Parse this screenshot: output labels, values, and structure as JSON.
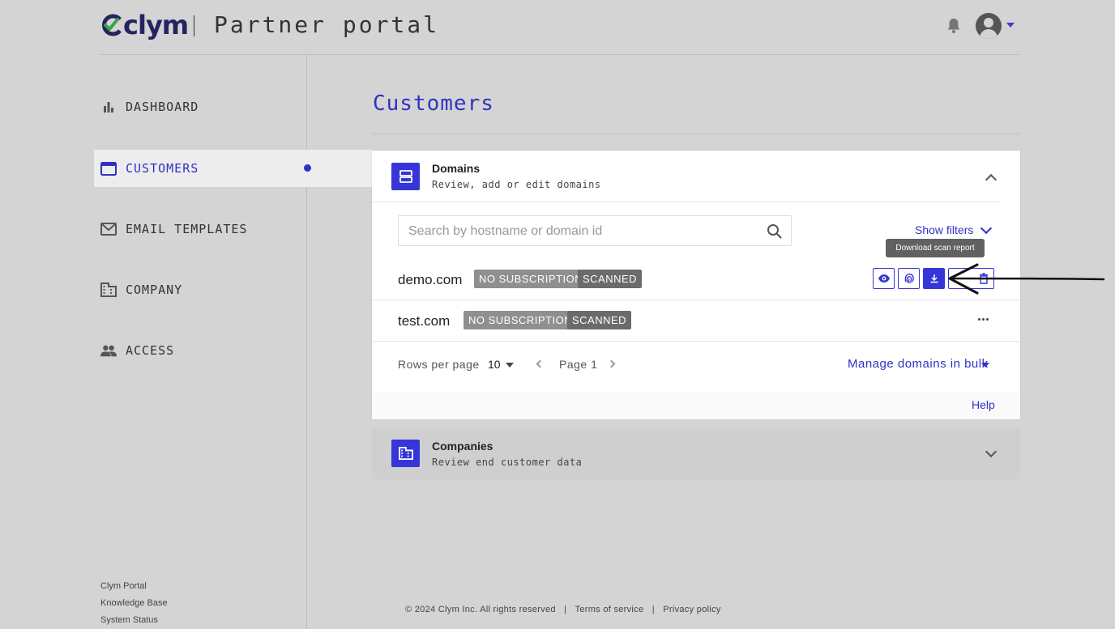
{
  "header": {
    "logo_text": "clym",
    "portal_title": "Partner portal"
  },
  "sidebar": {
    "items": [
      {
        "label": "DASHBOARD",
        "icon": "bar-chart-icon"
      },
      {
        "label": "CUSTOMERS",
        "icon": "window-icon",
        "active": true
      },
      {
        "label": "EMAIL TEMPLATES",
        "icon": "mail-icon"
      },
      {
        "label": "COMPANY",
        "icon": "building-icon"
      },
      {
        "label": "ACCESS",
        "icon": "people-icon"
      }
    ],
    "footer_links": [
      "Clym Portal",
      "Knowledge Base",
      "System Status"
    ]
  },
  "main": {
    "title": "Customers",
    "domains_panel": {
      "title": "Domains",
      "subtitle": "Review, add or edit domains",
      "search_placeholder": "Search by hostname or domain id",
      "show_filters": "Show filters",
      "tooltip": "Download scan report",
      "rows": [
        {
          "host": "demo.com",
          "badges": [
            "NO SUBSCRIPTION",
            "SCANNED"
          ]
        },
        {
          "host": "test.com",
          "badges": [
            "NO SUBSCRIPTION",
            "SCANNED"
          ]
        }
      ],
      "rows_per_page_label": "Rows per page",
      "rows_per_page_value": "10",
      "page_label": "Page 1",
      "bulk_label": "Manage domains in bulk",
      "help_label": "Help"
    },
    "companies_panel": {
      "title": "Companies",
      "subtitle": "Review end customer data"
    }
  },
  "footer": {
    "copyright": "© 2024 Clym Inc. All rights reserved",
    "terms": "Terms of service",
    "privacy": "Privacy policy"
  },
  "colors": {
    "accent": "#3636d8",
    "background": "#d4d4d4",
    "logo_green": "#3aa14a",
    "logo_navy": "#262262"
  }
}
